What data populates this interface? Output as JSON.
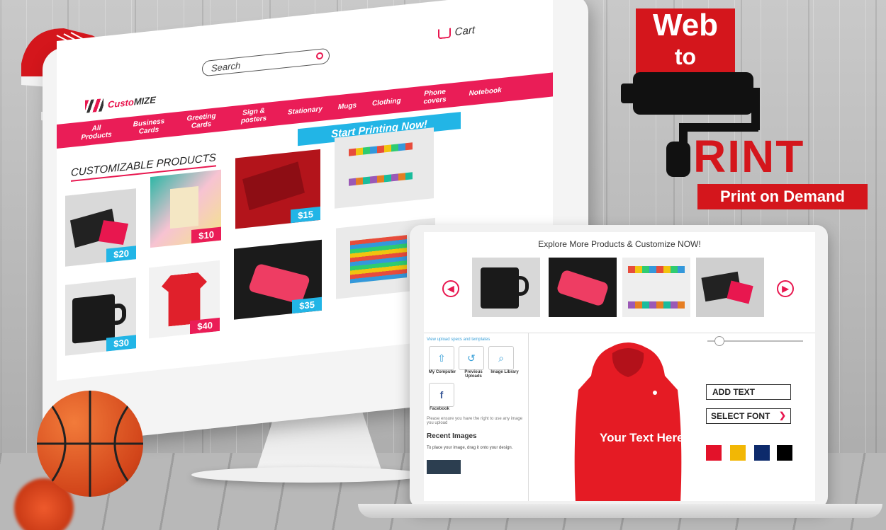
{
  "site": {
    "cart_label": "Cart",
    "search_placeholder": "Search",
    "logo_text_a": "Custo",
    "logo_text_b": "MIZE",
    "nav": [
      "All Products",
      "Business Cards",
      "Greeting Cards",
      "Sign & posters",
      "Stationary",
      "Mugs",
      "Clothing",
      "Phone covers",
      "Notebook"
    ],
    "cta_label": "Start Printing Now!",
    "section_title": "CUSTOMIZABLE PRODUCTS",
    "products": [
      {
        "name": "business-card",
        "price": "$20"
      },
      {
        "name": "greeting-card",
        "price": "$10"
      },
      {
        "name": "poster",
        "price": "$15"
      },
      {
        "name": "stationery",
        "price": ""
      },
      {
        "name": "mug",
        "price": "$30"
      },
      {
        "name": "tshirt",
        "price": "$40"
      },
      {
        "name": "phone-cover",
        "price": "$35"
      },
      {
        "name": "notebook",
        "price": ""
      }
    ]
  },
  "customizer": {
    "explore_title": "Explore More Products & Customize NOW!",
    "upload_hint": "View upload specs and templates",
    "buttons": [
      "My Computer",
      "Previous Uploads",
      "Image Library"
    ],
    "facebook_label": "Facebook",
    "rights_note": "Please ensure you have the right to use any image you upload",
    "recent_title": "Recent Images",
    "recent_hint": "To place your image, drag it onto your design.",
    "hoodie_text": "Your Text Here",
    "add_text_label": "ADD TEXT",
    "select_font_label": "SELECT FONT",
    "swatches": [
      "#e3122a",
      "#f2b705",
      "#0d2a6b",
      "#000000"
    ]
  },
  "branding": {
    "line1": "Web",
    "line2": "to",
    "line3": "RINT",
    "tagline": "Print on Demand"
  },
  "colors": {
    "accent": "#ea1d57",
    "cyan": "#22b5e6",
    "brand_red": "#d4161c"
  }
}
